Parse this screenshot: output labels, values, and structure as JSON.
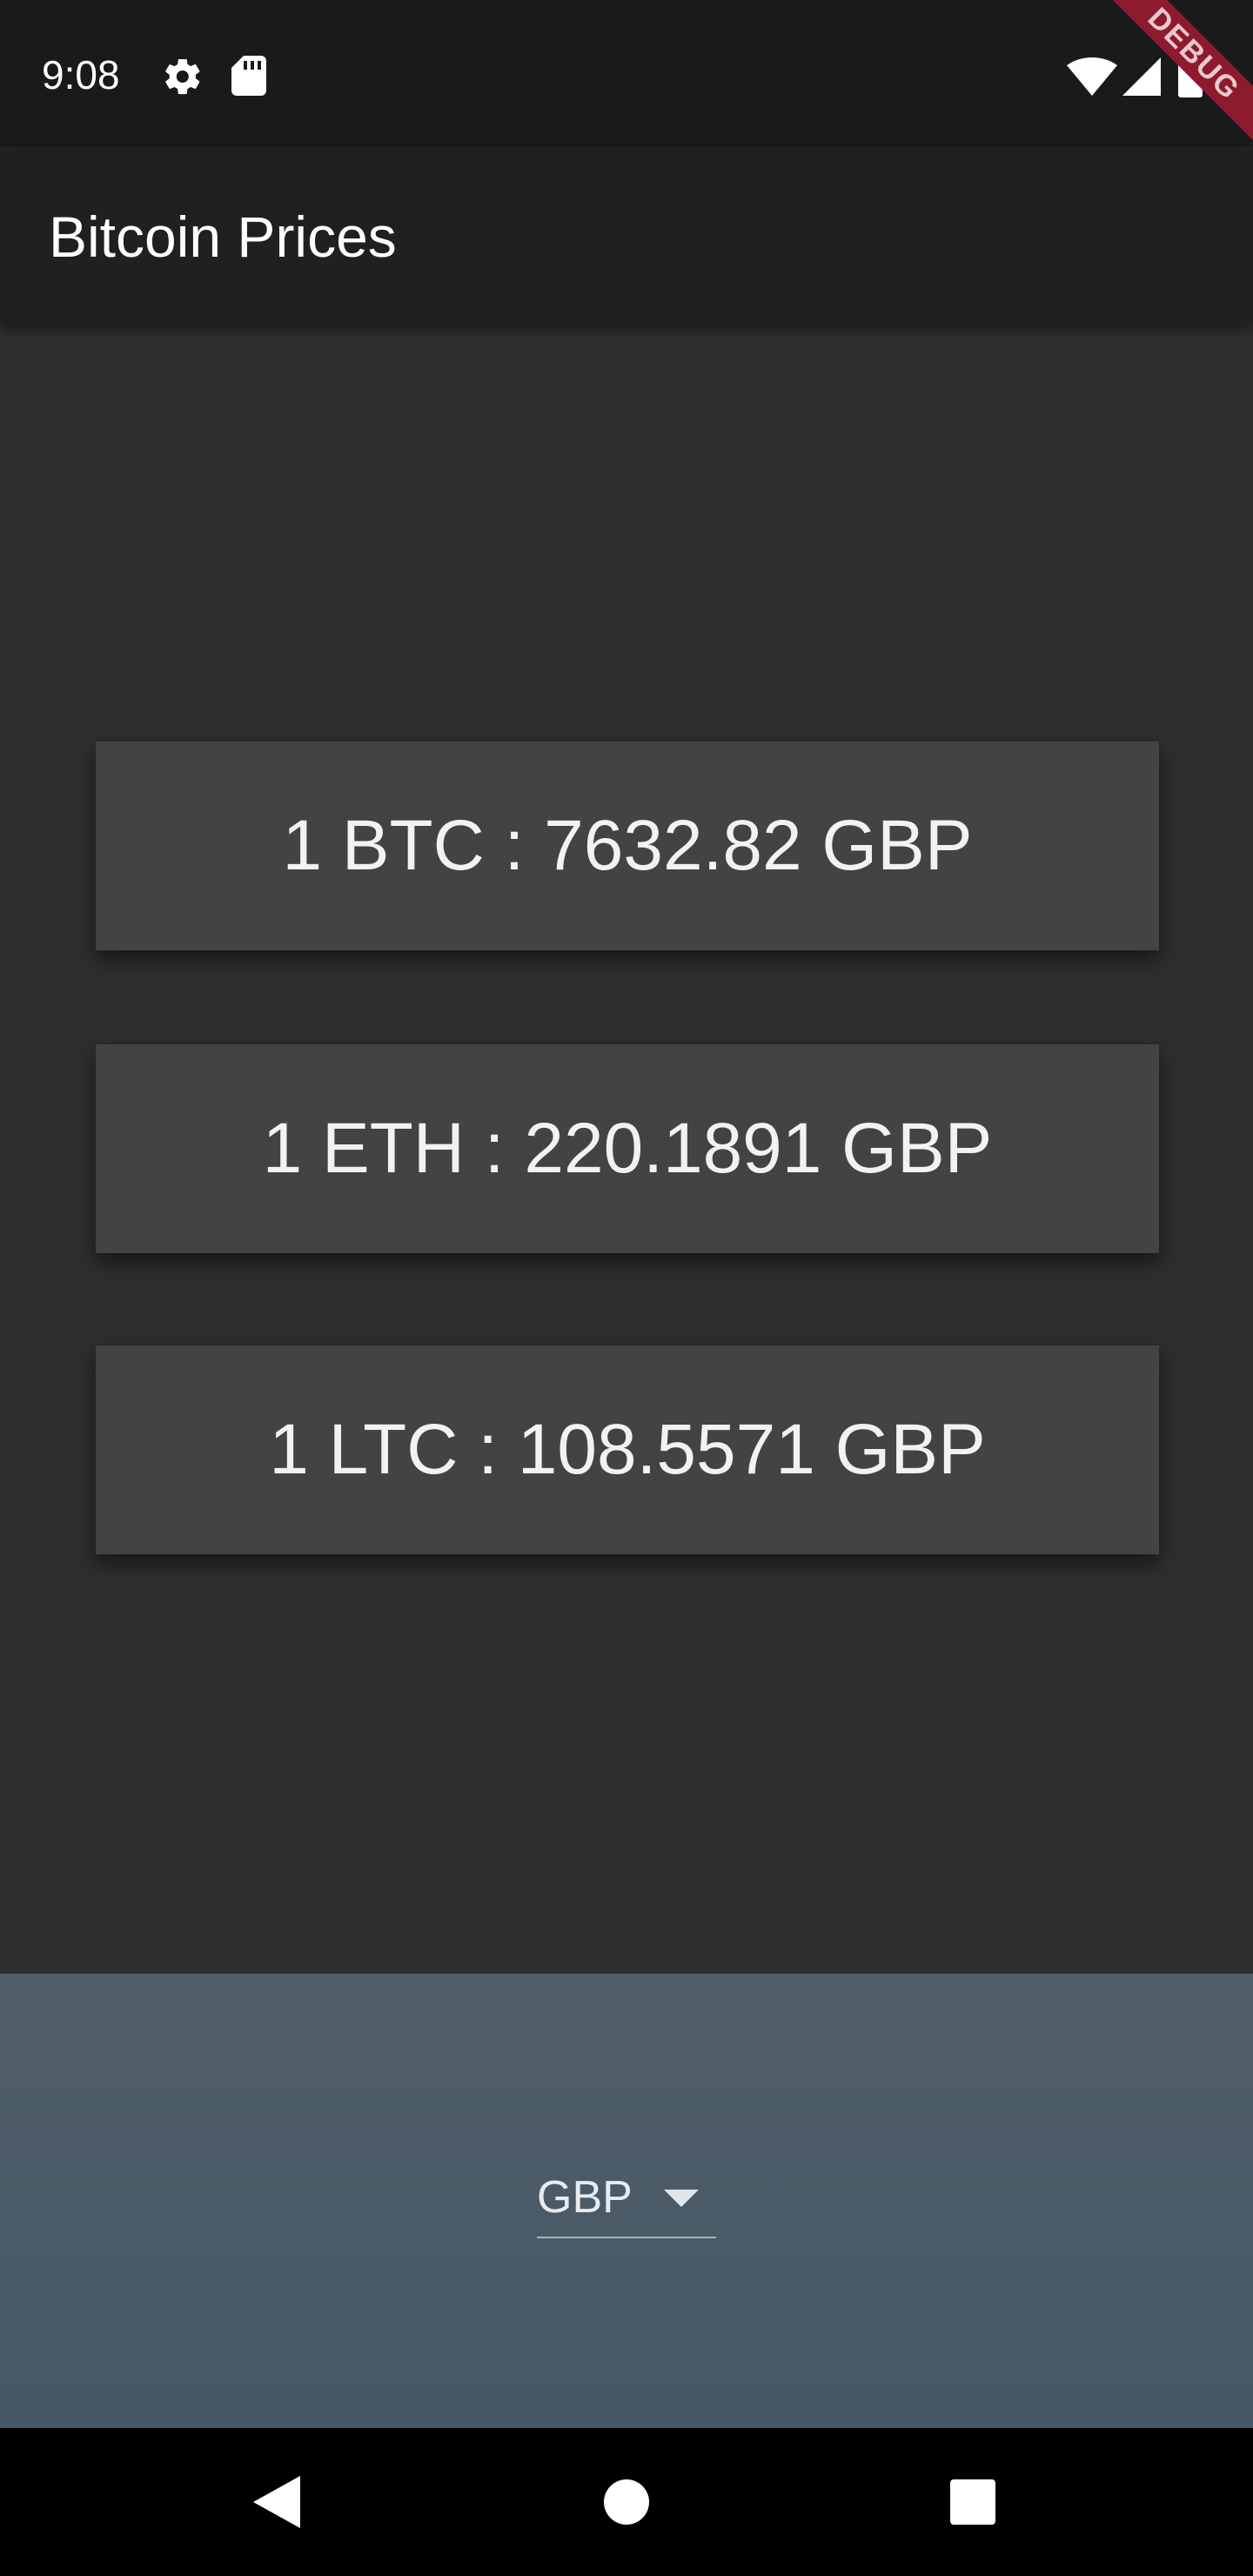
{
  "status_bar": {
    "time": "9:08",
    "icons_left": [
      "gear-icon",
      "sd-card-icon"
    ],
    "icons_right": [
      "wifi-icon",
      "cellular-signal-icon",
      "battery-icon"
    ]
  },
  "debug_banner": {
    "label": "DEBUG"
  },
  "app_bar": {
    "title": "Bitcoin Prices"
  },
  "prices": [
    {
      "text": "1 BTC : 7632.82 GBP"
    },
    {
      "text": "1 ETH : 220.1891 GBP"
    },
    {
      "text": "1 LTC : 108.5571 GBP"
    }
  ],
  "currency_picker": {
    "selected": "GBP"
  },
  "nav_bar": {
    "buttons": [
      "back-icon",
      "home-icon",
      "recents-icon"
    ]
  },
  "colors": {
    "background": "#2f2d2d",
    "app_bar": "#212020",
    "card": "#444242",
    "picker_area": "#4c5b66",
    "debug_banner": "#8e1b2d"
  }
}
